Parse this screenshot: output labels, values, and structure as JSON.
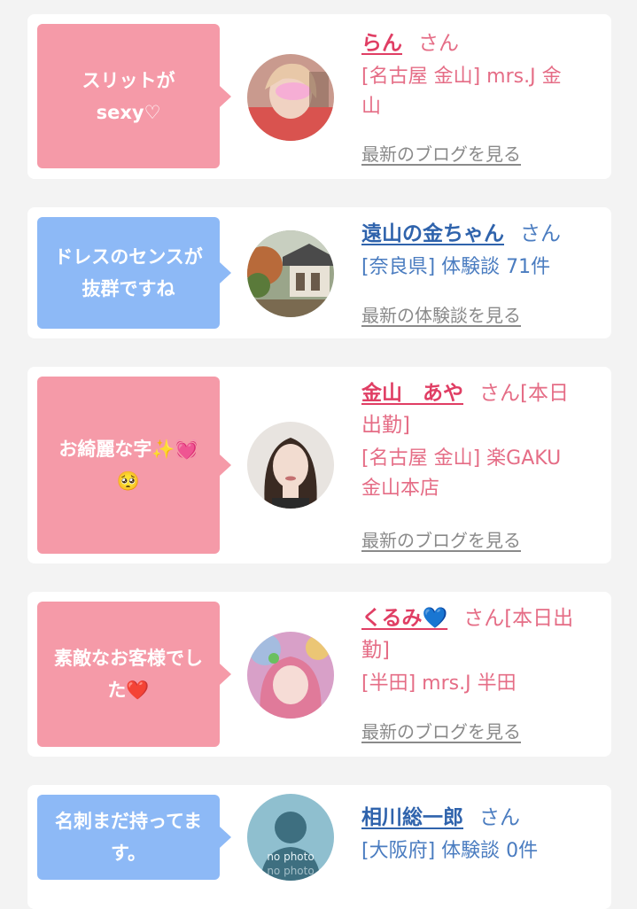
{
  "cards": [
    {
      "comment": [
        "スリットが",
        "sexy♡"
      ],
      "name": "らん",
      "honorific": "さん",
      "details": [
        "[名古屋 金山] mrs.J 金",
        "山"
      ],
      "link": "最新のブログを見る",
      "avatar_icon": "woman-selfie-photo"
    },
    {
      "comment": [
        "ドレスのセンスが",
        "抜群ですね"
      ],
      "name": "遠山の金ちゃん",
      "honorific": "さん",
      "details": [
        "[奈良県] 体験談 71件"
      ],
      "link": "最新の体験談を見る",
      "avatar_icon": "temple-photo"
    },
    {
      "comment": [
        "お綺麗な字✨💓",
        "🥺"
      ],
      "name": "金山　あや",
      "honorific": "さん[本日",
      "honorific2": "出勤]",
      "details": [
        "[名古屋 金山] 楽GAKU",
        "金山本店"
      ],
      "link": "最新のブログを見る",
      "avatar_icon": "woman-portrait-photo"
    },
    {
      "comment": [
        "素敵なお客様でし",
        "た❤️"
      ],
      "name": "くるみ💙",
      "honorific": "さん[本日出",
      "honorific2": "勤]",
      "details": [
        "[半田] mrs.J 半田"
      ],
      "link": "最新のブログを見る",
      "avatar_icon": "woman-filter-photo"
    },
    {
      "comment": [
        "名刺まだ持ってま",
        "す。"
      ],
      "name": "相川総一郎",
      "honorific": "さん",
      "details": [
        "[大阪府] 体験談 0件"
      ],
      "avatar_icon": "no-photo-silhouette",
      "avatar_text": [
        "no photo",
        "no photo"
      ]
    }
  ],
  "colors": {
    "pink": "#f59aa8",
    "blue": "#8db9f6",
    "pink_text": "#e03e64",
    "blue_text": "#2f63ac"
  }
}
